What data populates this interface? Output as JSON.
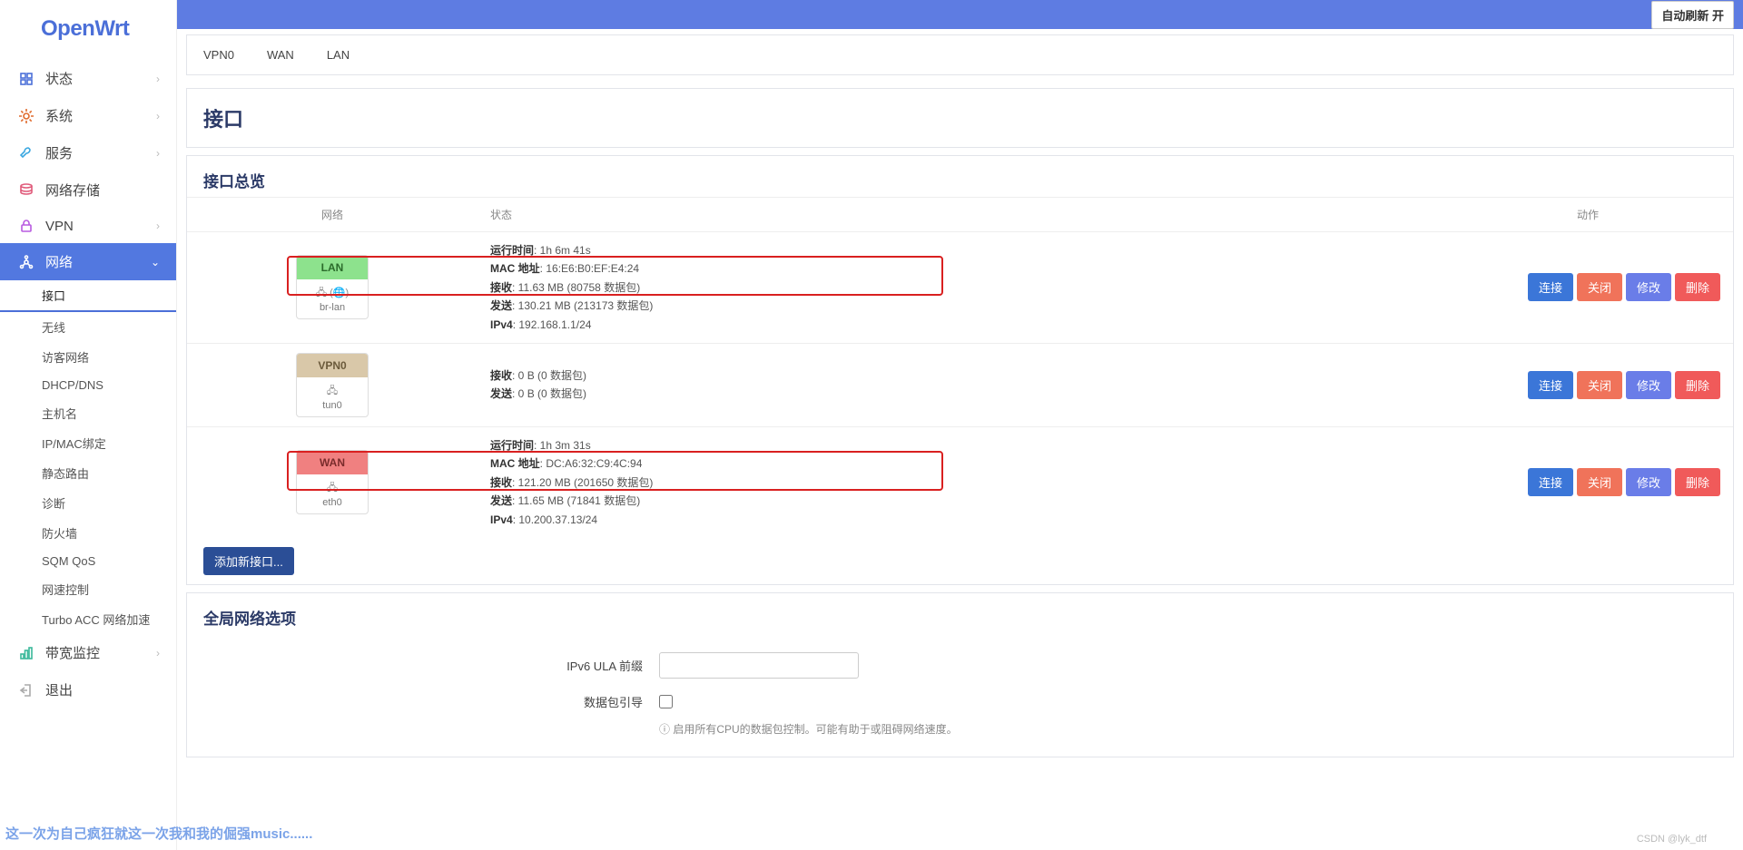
{
  "logo": "OpenWrt",
  "autoRefresh": "自动刷新 开",
  "tabs": [
    "VPN0",
    "WAN",
    "LAN"
  ],
  "pageTitle": "接口",
  "overviewTitle": "接口总览",
  "tableHead": {
    "net": "网络",
    "status": "状态",
    "act": "动作"
  },
  "interfaces": [
    {
      "name": "LAN",
      "class": "lan",
      "ports": "🖧 (🌐)",
      "dev": "br-lan",
      "lines": [
        {
          "k": "运行时间",
          "v": "1h 6m 41s"
        },
        {
          "k": "MAC 地址",
          "v": "16:E6:B0:EF:E4:24"
        },
        {
          "k": "接收",
          "v": "11.63 MB (80758 数据包)"
        },
        {
          "k": "发送",
          "v": "130.21 MB (213173 数据包)"
        },
        {
          "k": "IPv4",
          "v": "192.168.1.1/24"
        }
      ],
      "highlight": true,
      "hlTop": 26,
      "hlH": 44
    },
    {
      "name": "VPN0",
      "class": "vpn",
      "ports": "🖧",
      "dev": "tun0",
      "lines": [
        {
          "k": "接收",
          "v": "0 B (0 数据包)"
        },
        {
          "k": "发送",
          "v": "0 B (0 数据包)"
        }
      ],
      "highlight": false
    },
    {
      "name": "WAN",
      "class": "wan",
      "ports": "🖧",
      "dev": "eth0",
      "lines": [
        {
          "k": "运行时间",
          "v": "1h 3m 31s"
        },
        {
          "k": "MAC 地址",
          "v": "DC:A6:32:C9:4C:94"
        },
        {
          "k": "接收",
          "v": "121.20 MB (201650 数据包)"
        },
        {
          "k": "发送",
          "v": "11.65 MB (71841 数据包)"
        },
        {
          "k": "IPv4",
          "v": "10.200.37.13/24"
        }
      ],
      "highlight": true,
      "hlTop": 26,
      "hlH": 44
    }
  ],
  "actions": {
    "connect": "连接",
    "close": "关闭",
    "edit": "修改",
    "delete": "删除"
  },
  "addBtn": "添加新接口...",
  "globalTitle": "全局网络选项",
  "ulaLabel": "IPv6 ULA 前缀",
  "ulaValue": "",
  "steerLabel": "数据包引导",
  "steerHint": "启用所有CPU的数据包控制。可能有助于或阻碍网络速度。",
  "nav": [
    {
      "icon": "grid",
      "label": "状态",
      "color": "#4b6fd8",
      "chev": true
    },
    {
      "icon": "gear",
      "label": "系统",
      "color": "#e06a2c",
      "chev": true
    },
    {
      "icon": "wrench",
      "label": "服务",
      "color": "#3aa7e0",
      "chev": true
    },
    {
      "icon": "db",
      "label": "网络存储",
      "color": "#e05a7a",
      "chev": false
    },
    {
      "icon": "lock",
      "label": "VPN",
      "color": "#b85ae0",
      "chev": true
    },
    {
      "icon": "net",
      "label": "网络",
      "color": "#fff",
      "chev": true,
      "active": true
    }
  ],
  "subnav": [
    "接口",
    "无线",
    "访客网络",
    "DHCP/DNS",
    "主机名",
    "IP/MAC绑定",
    "静态路由",
    "诊断",
    "防火墙",
    "SQM QoS",
    "网速控制",
    "Turbo ACC 网络加速"
  ],
  "subnavActive": 0,
  "navBottom": [
    {
      "icon": "bw",
      "label": "带宽监控",
      "color": "#3ab89a",
      "chev": true
    },
    {
      "icon": "exit",
      "label": "退出",
      "color": "#aaa",
      "chev": false
    }
  ],
  "footerText": "这一次为自己疯狂就这一次我和我的倔强music......",
  "watermark": "CSDN @lyk_dtf"
}
